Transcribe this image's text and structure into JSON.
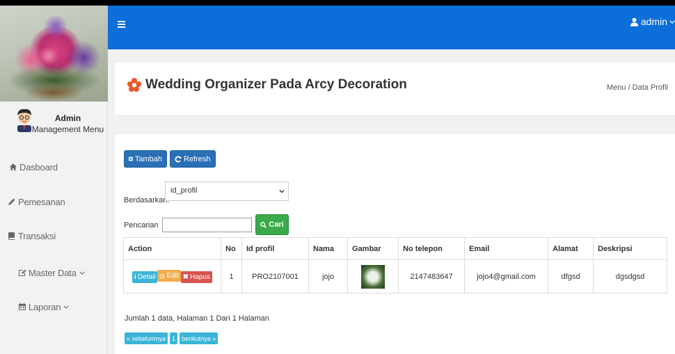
{
  "topbar": {
    "user_label": "admin",
    "accent": "#0b6ed9"
  },
  "sidebar": {
    "admin_name": "Admin",
    "admin_role": "Management Menu",
    "items": [
      {
        "label": "Dasboard",
        "icon": "home-icon"
      },
      {
        "label": "Pemesanan",
        "icon": "pencil-icon"
      },
      {
        "label": "Transaksi",
        "icon": "book-icon"
      },
      {
        "label": "Master Data",
        "icon": "edit-icon",
        "has_chevron": true
      },
      {
        "label": "Laporan",
        "icon": "calendar-icon",
        "has_chevron": true
      }
    ]
  },
  "header": {
    "title": "Wedding Organizer Pada Arcy Decoration",
    "breadcrumb": "Menu / Data Profil"
  },
  "toolbar": {
    "add_label": "Tambah",
    "refresh_label": "Refresh"
  },
  "filter": {
    "by_label": "Berdasarkan:",
    "by_value": "id_profil",
    "search_label": "Pencarian",
    "search_value": "",
    "search_button": "Cari"
  },
  "table": {
    "headers": [
      "Action",
      "No",
      "Id profil",
      "Nama",
      "Gambar",
      "No telepon",
      "Email",
      "Alamat",
      "Deskripsi"
    ],
    "actions": {
      "detail": "Detail",
      "edit": "Edit",
      "delete": "Hapus"
    },
    "rows": [
      {
        "no": "1",
        "id_profil": "PRO2107001",
        "nama": "jojo",
        "no_telepon": "2147483647",
        "email": "jojo4@gmail.com",
        "alamat": "dfgsd",
        "deskripsi": "dgsdgsd"
      }
    ]
  },
  "summary": "Jumlah 1 data, Halaman 1 Dari 1 Halaman",
  "pagination": {
    "prev": "« sebelumnya",
    "current": "1",
    "next": "berikutnya »"
  }
}
